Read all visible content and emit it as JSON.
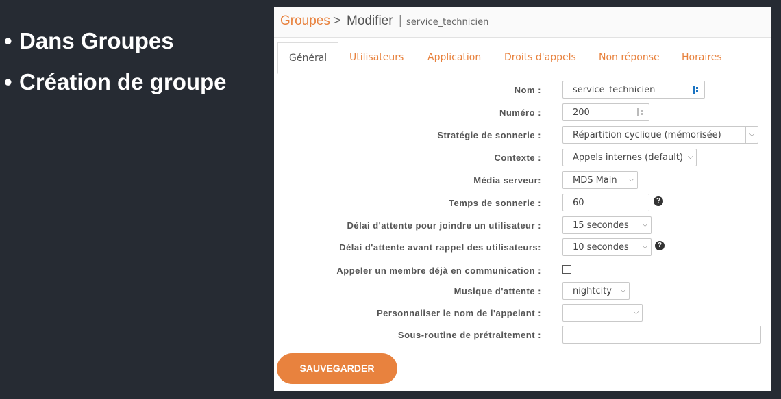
{
  "slide": {
    "bullets": [
      "Dans Groupes",
      "Création de groupe"
    ]
  },
  "breadcrumb": {
    "section": "Groupes",
    "separator": ">",
    "action": "Modifier",
    "pipe": "|",
    "item": "service_technicien"
  },
  "tabs": [
    {
      "label": "Général",
      "active": true
    },
    {
      "label": "Utilisateurs",
      "active": false
    },
    {
      "label": "Application",
      "active": false
    },
    {
      "label": "Droits d'appels",
      "active": false
    },
    {
      "label": "Non réponse",
      "active": false
    },
    {
      "label": "Horaires",
      "active": false
    }
  ],
  "form": {
    "nom": {
      "label": "Nom :",
      "value": "service_technicien"
    },
    "numero": {
      "label": "Numéro :",
      "value": "200"
    },
    "strategie": {
      "label": "Stratégie de sonnerie :",
      "value": "Répartition cyclique (mémorisée)"
    },
    "contexte": {
      "label": "Contexte :",
      "value": "Appels internes (default)"
    },
    "media": {
      "label": "Média serveur:",
      "value": "MDS Main"
    },
    "temps": {
      "label": "Temps de sonnerie :",
      "value": "60"
    },
    "delai_joindre": {
      "label": "Délai d'attente pour joindre un utilisateur :",
      "value": "15 secondes"
    },
    "delai_rappel": {
      "label": "Délai d'attente avant rappel des utilisateurs:",
      "value": "10 secondes"
    },
    "appeler_membre": {
      "label": "Appeler un membre déjà en communication :",
      "checked": false
    },
    "musique": {
      "label": "Musique d'attente :",
      "value": "nightcity"
    },
    "personnaliser": {
      "label": "Personnaliser le nom de l'appelant :",
      "value": ""
    },
    "sous_routine": {
      "label": "Sous-routine de prétraitement :",
      "value": ""
    }
  },
  "help_glyph": "?",
  "caret_glyph": "⌵",
  "save_label": "SAUVEGARDER",
  "colors": {
    "accent": "#e8823e",
    "background": "#262b33"
  }
}
